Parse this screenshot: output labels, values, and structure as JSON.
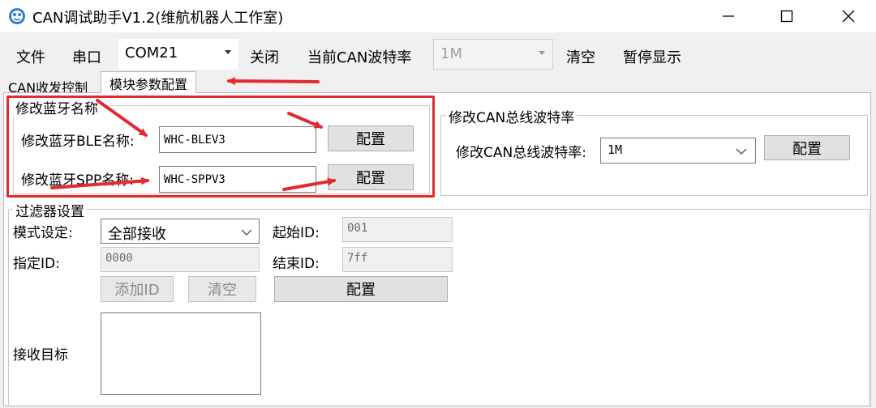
{
  "window": {
    "title": "CAN调试助手V1.2(维航机器人工作室)"
  },
  "toolbar": {
    "file": "文件",
    "serial": "串口",
    "port_value": "COM21",
    "close": "关闭",
    "baud_label": "当前CAN波特率",
    "baud_value": "1M",
    "clear": "清空",
    "pause": "暂停显示"
  },
  "tabs": [
    "CAN收发控制",
    "模块参数配置"
  ],
  "bt_group": {
    "title": "修改蓝牙名称",
    "ble_label": "修改蓝牙BLE名称:",
    "ble_value": "WHC-BLEV3",
    "spp_label": "修改蓝牙SPP名称:",
    "spp_value": "WHC-SPPV3",
    "config": "配置"
  },
  "can_group": {
    "title": "修改CAN总线波特率",
    "label": "修改CAN总线波特率:",
    "value": "1M",
    "config": "配置"
  },
  "filter_group": {
    "title": "过滤器设置",
    "mode_label": "模式设定:",
    "mode_value": "全部接收",
    "start_label": "起始ID:",
    "start_value": "001",
    "specify_label": "指定ID:",
    "specify_value": "0000",
    "end_label": "结束ID:",
    "end_value": "7ff",
    "add_id": "添加ID",
    "clear": "清空",
    "config": "配置",
    "target_label": "接收目标"
  },
  "colors": {
    "annotation": "#e22a2f",
    "tab_page": "#ffffff",
    "window_bg": "#f0f0f0"
  }
}
